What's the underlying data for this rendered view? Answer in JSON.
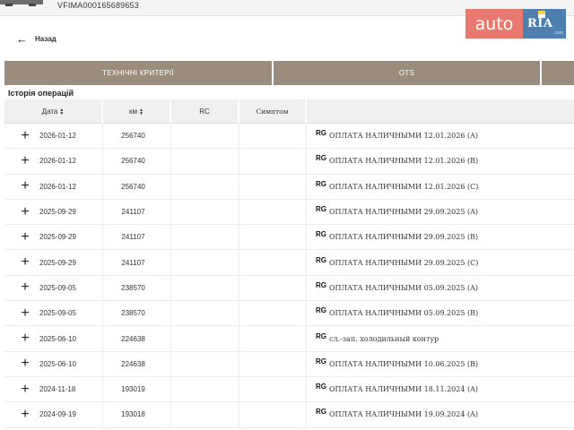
{
  "header": {
    "vin": "VFIMA000165689653",
    "back_label": "Назад"
  },
  "logo": {
    "auto": "auto",
    "ria": "RIA",
    "com": ".com"
  },
  "tabs": [
    {
      "label": "ТЕХНІЧНІ КРИТЕРІЇ"
    },
    {
      "label": "OTS"
    },
    {
      "label": ""
    }
  ],
  "section_title": "Історія операцій",
  "table": {
    "columns": {
      "date": "Дата",
      "km": "км",
      "rc": "RC",
      "symptom": "Симптом",
      "description": ""
    },
    "rows": [
      {
        "date": "2026-01-12",
        "km": "256740",
        "badge": "RG",
        "description": "ОПЛАТА НАЛИЧНЫМИ 12.01.2026 (A)"
      },
      {
        "date": "2026-01-12",
        "km": "256740",
        "badge": "RG",
        "description": "ОПЛАТА НАЛИЧНЫМИ 12.01.2026 (B)"
      },
      {
        "date": "2026-01-12",
        "km": "256740",
        "badge": "RG",
        "description": "ОПЛАТА НАЛИЧНЫМИ 12.01.2026 (C)"
      },
      {
        "date": "2025-09-29",
        "km": "241107",
        "badge": "RG",
        "description": "ОПЛАТА НАЛИЧНЫМИ 29.09.2025 (A)"
      },
      {
        "date": "2025-09-29",
        "km": "241107",
        "badge": "RG",
        "description": "ОПЛАТА НАЛИЧНЫМИ 29.09.2025 (B)"
      },
      {
        "date": "2025-09-29",
        "km": "241107",
        "badge": "RG",
        "description": "ОПЛАТА НАЛИЧНЫМИ 29.09.2025 (C)"
      },
      {
        "date": "2025-09-05",
        "km": "238570",
        "badge": "RG",
        "description": "ОПЛАТА НАЛИЧНЫМИ 05.09.2025 (A)"
      },
      {
        "date": "2025-09-05",
        "km": "238570",
        "badge": "RG",
        "description": "ОПЛАТА НАЛИЧНЫМИ 05.09.2025 (B)"
      },
      {
        "date": "2025-06-10",
        "km": "224638",
        "badge": "RG",
        "description": "сл.-зап. холодильный контур"
      },
      {
        "date": "2025-06-10",
        "km": "224638",
        "badge": "RG",
        "description": "ОПЛАТА НАЛИЧНЫМИ 10.06.2025 (B)"
      },
      {
        "date": "2024-11-18",
        "km": "193019",
        "badge": "RG",
        "description": "ОПЛАТА НАЛИЧНЫМИ 18.11.2024 (A)"
      },
      {
        "date": "2024-09-19",
        "km": "193018",
        "badge": "RG",
        "description": "ОПЛАТА НАЛИЧНЫМИ 19.09.2024 (A)"
      }
    ]
  },
  "colors": {
    "tab_bar": "#9a8d7d",
    "logo_auto": "#e9796f",
    "logo_ria": "#4e7fae",
    "header_row": "#f0f0f0"
  },
  "icons": {
    "back": "arrow-left-icon",
    "expand": "plus-icon",
    "sort": "sort-icon"
  }
}
